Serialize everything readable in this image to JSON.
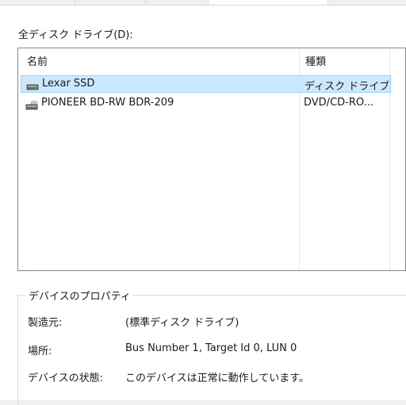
{
  "drives_label": "全ディスク ドライブ(D):",
  "list": {
    "columns": [
      "名前",
      "種類"
    ],
    "rows": [
      {
        "name": "Lexar SSD",
        "type": "ディスク ドライブ",
        "icon": "hard-disk-icon",
        "selected": true
      },
      {
        "name": "PIONEER BD-RW   BDR-209",
        "type": "DVD/CD-RO...",
        "icon": "optical-drive-icon",
        "selected": false
      }
    ]
  },
  "properties": {
    "title": "デバイスのプロパティ",
    "manufacturer_label": "製造元:",
    "manufacturer_value": "(標準ディスク ドライブ)",
    "location_label": "場所:",
    "location_value": "Bus Number 1, Target Id 0, LUN 0",
    "status_label": "デバイスの状態:",
    "status_value": "このデバイスは正常に動作しています。"
  },
  "colors": {
    "selection_bg": "#cce8ff",
    "selection_border": "#99d1ff",
    "list_border": "#828790"
  }
}
